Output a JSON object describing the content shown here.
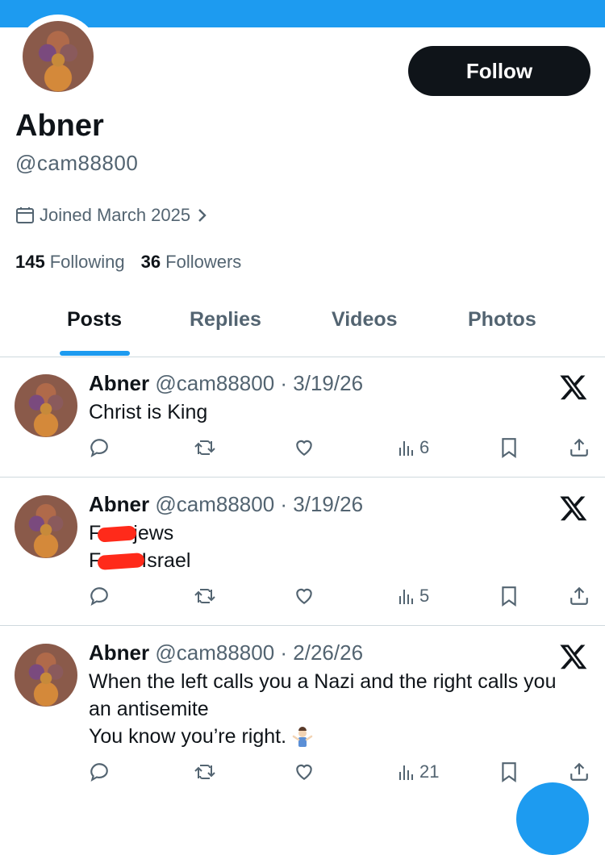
{
  "profile": {
    "name": "Abner",
    "handle": "@cam88800",
    "joined": "Joined March 2025",
    "follow_label": "Follow",
    "following_count": "145",
    "following_label": "Following",
    "followers_count": "36",
    "followers_label": "Followers"
  },
  "tabs": [
    {
      "label": "Posts"
    },
    {
      "label": "Replies"
    },
    {
      "label": "Videos"
    },
    {
      "label": "Photos"
    }
  ],
  "tweets": [
    {
      "name": "Abner",
      "meta": "@cam88800 · 3/19/26",
      "lines": [
        "Christ is King"
      ],
      "views": "6"
    },
    {
      "name": "Abner",
      "meta": "@cam88800 · 3/19/26",
      "lines_prefix": [
        "F",
        "F"
      ],
      "lines_suffix": [
        "jews",
        "Israel"
      ],
      "views": "5"
    },
    {
      "name": "Abner",
      "meta": "@cam88800 · 2/26/26",
      "lines": [
        "When the left calls you a Nazi and the right calls you",
        "an antisemite",
        "You know you’re right."
      ],
      "views": "21"
    }
  ],
  "colors": {
    "accent": "#1d9bf0",
    "text": "#0f1419",
    "muted": "#536471",
    "redaction": "#ff2a1a"
  },
  "icons": [
    "calendar-icon",
    "chevron-right-icon",
    "x-logo-icon",
    "reply-icon",
    "retweet-icon",
    "like-icon",
    "views-icon",
    "bookmark-icon",
    "share-icon",
    "shrug-emoji-icon"
  ]
}
